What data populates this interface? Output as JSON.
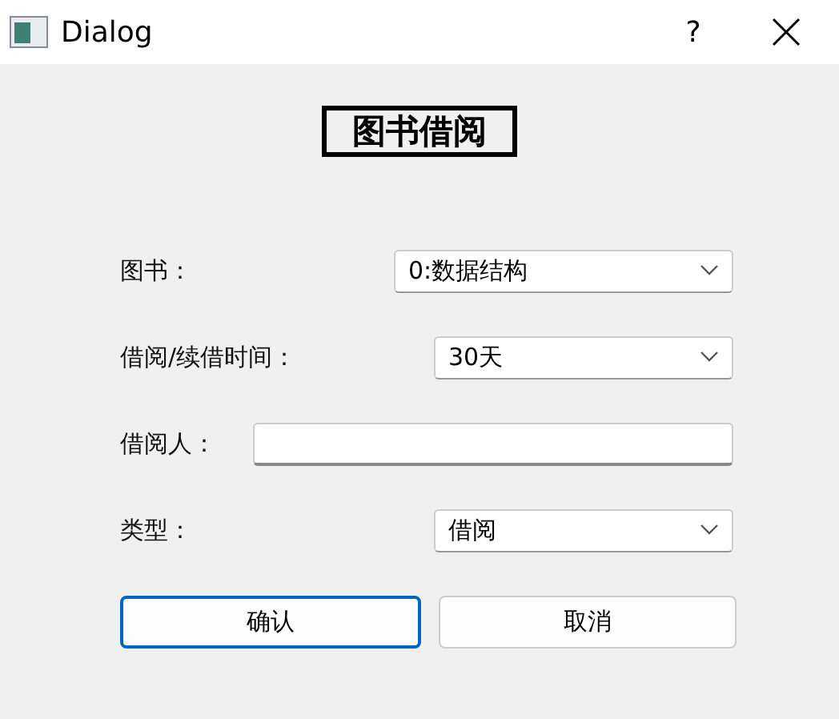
{
  "window": {
    "title": "Dialog",
    "help": "?"
  },
  "heading": "图书借阅",
  "fields": [
    {
      "label": "图书：",
      "kind": "combo",
      "value": "0:数据结构"
    },
    {
      "label": "借阅/续借时间：",
      "kind": "combo",
      "value": "30天"
    },
    {
      "label": "借阅人：",
      "kind": "text"
    },
    {
      "label": "类型：",
      "kind": "combo",
      "value": "借阅"
    }
  ],
  "buttons": [
    {
      "label": "确认",
      "focused": true
    },
    {
      "label": "取消",
      "focused": false
    }
  ]
}
